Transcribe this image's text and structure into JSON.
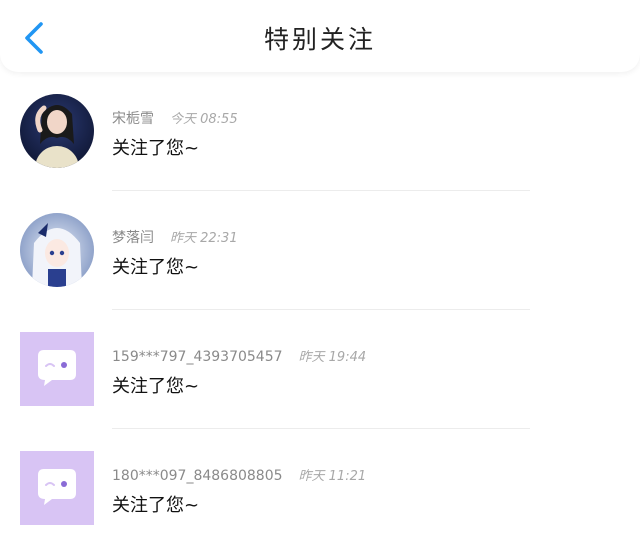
{
  "header": {
    "title": "特别关注",
    "back_icon": "chevron-left-icon"
  },
  "colors": {
    "accent": "#2196f3",
    "default_avatar_bg": "#d8c4f4",
    "default_avatar_dot": "#8a6bd6"
  },
  "notifications": [
    {
      "name": "宋栀雪",
      "time": "今天 08:55",
      "message": "关注了您~",
      "avatar": "photo-girl"
    },
    {
      "name": "梦落闫",
      "time": "昨天 22:31",
      "message": "关注了您~",
      "avatar": "anime-girl"
    },
    {
      "name": "159***797_4393705457",
      "time": "昨天 19:44",
      "message": "关注了您~",
      "avatar": "default-chat-bubble"
    },
    {
      "name": "180***097_8486808805",
      "time": "昨天 11:21",
      "message": "关注了您~",
      "avatar": "default-chat-bubble"
    }
  ]
}
